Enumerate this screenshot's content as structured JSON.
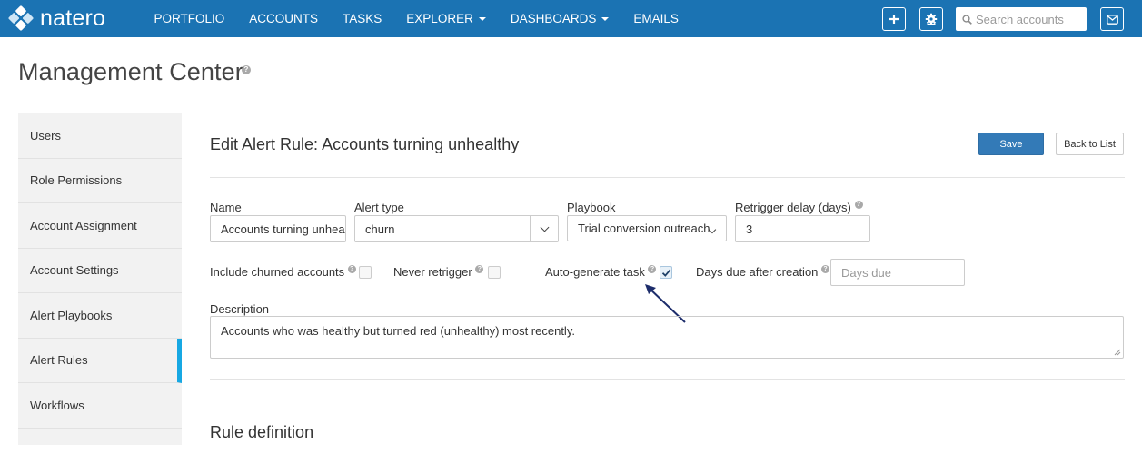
{
  "app": {
    "brand": "natero",
    "nav": [
      {
        "label": "PORTFOLIO",
        "has_caret": false
      },
      {
        "label": "ACCOUNTS",
        "has_caret": false
      },
      {
        "label": "TASKS",
        "has_caret": false
      },
      {
        "label": "EXPLORER",
        "has_caret": true
      },
      {
        "label": "DASHBOARDS",
        "has_caret": true
      },
      {
        "label": "EMAILS",
        "has_caret": false
      }
    ],
    "search_placeholder": "Search accounts",
    "icons": [
      "plus-icon",
      "gear-icon",
      "search-icon",
      "mail-icon"
    ],
    "brand_color": "#1b73b3"
  },
  "page": {
    "title": "Management Center"
  },
  "sidebar": {
    "items": [
      {
        "label": "Users",
        "active": false
      },
      {
        "label": "Role Permissions",
        "active": false
      },
      {
        "label": "Account Assignment",
        "active": false
      },
      {
        "label": "Account Settings",
        "active": false
      },
      {
        "label": "Alert Playbooks",
        "active": false
      },
      {
        "label": "Alert Rules",
        "active": true
      },
      {
        "label": "Workflows",
        "active": false
      }
    ],
    "active_color": "#17a8e3"
  },
  "main": {
    "title": "Edit Alert Rule: Accounts turning unhealthy",
    "save_label": "Save",
    "back_label": "Back to List",
    "form": {
      "name_label": "Name",
      "name_value": "Accounts turning unhealthy",
      "alert_type_label": "Alert type",
      "alert_type_value": "churn",
      "playbook_label": "Playbook",
      "playbook_value": "Trial conversion outreach",
      "retrigger_label": "Retrigger delay (days)",
      "retrigger_value": "3",
      "include_churned_label": "Include churned accounts",
      "include_churned_checked": false,
      "never_retrigger_label": "Never retrigger",
      "never_retrigger_checked": false,
      "auto_task_label": "Auto-generate task",
      "auto_task_checked": true,
      "days_due_label": "Days due after creation",
      "days_due_placeholder": "Days due",
      "description_label": "Description",
      "description_value": "Accounts who was healthy but turned red (unhealthy) most recently."
    },
    "rule_definition_title": "Rule definition"
  }
}
